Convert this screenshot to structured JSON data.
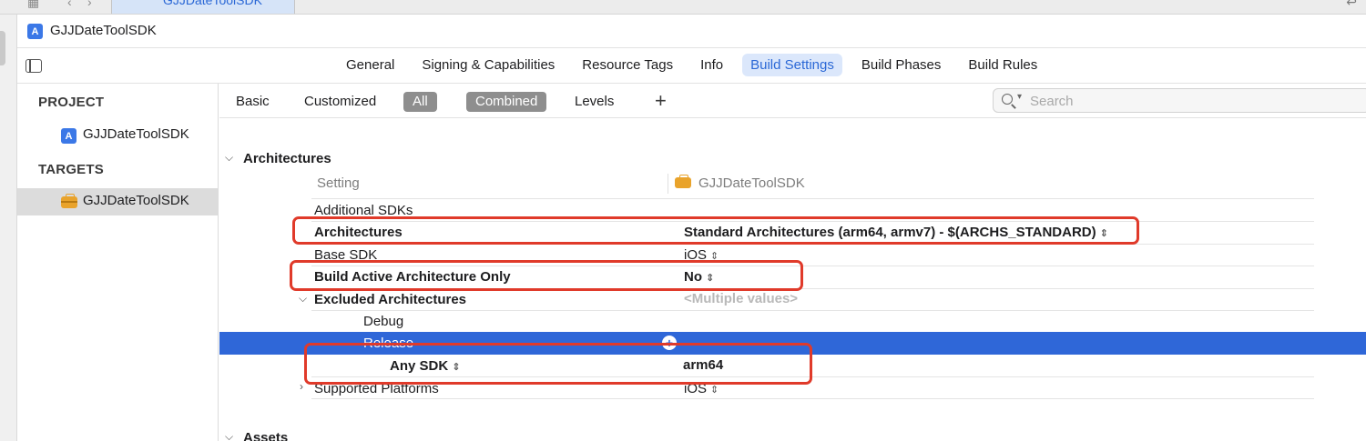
{
  "top": {
    "active_tab": "GJJDateToolSDK"
  },
  "jumpbar": {
    "title": "GJJDateToolSDK"
  },
  "tabs": [
    "General",
    "Signing & Capabilities",
    "Resource Tags",
    "Info",
    "Build Settings",
    "Build Phases",
    "Build Rules"
  ],
  "sidebar": {
    "project_header": "PROJECT",
    "project_item": "GJJDateToolSDK",
    "targets_header": "TARGETS",
    "target_item": "GJJDateToolSDK"
  },
  "filter": {
    "basic": "Basic",
    "customized": "Customized",
    "all": "All",
    "combined": "Combined",
    "levels": "Levels",
    "plus": "+",
    "search_placeholder": "Search"
  },
  "section": {
    "title": "Architectures",
    "col_setting": "Setting",
    "col_target": "GJJDateToolSDK",
    "next_title": "Assets"
  },
  "rows": {
    "additional_sdks": {
      "name": "Additional SDKs",
      "value": ""
    },
    "architectures": {
      "name": "Architectures",
      "value": "Standard Architectures (arm64, armv7)  -  $(ARCHS_STANDARD)"
    },
    "base_sdk": {
      "name": "Base SDK",
      "value": "iOS"
    },
    "build_active": {
      "name": "Build Active Architecture Only",
      "value": "No"
    },
    "excluded": {
      "name": "Excluded Architectures",
      "value": "<Multiple values>"
    },
    "debug": {
      "name": "Debug",
      "value": ""
    },
    "release": {
      "name": "Release",
      "value": ""
    },
    "any_sdk": {
      "name": "Any SDK",
      "value": "arm64"
    },
    "supported_platforms": {
      "name": "Supported Platforms",
      "value": "iOS"
    }
  },
  "colors": {
    "accent": "#2f67d8",
    "highlight_box": "#e03a2a",
    "target_icon": "#e9a32b"
  }
}
